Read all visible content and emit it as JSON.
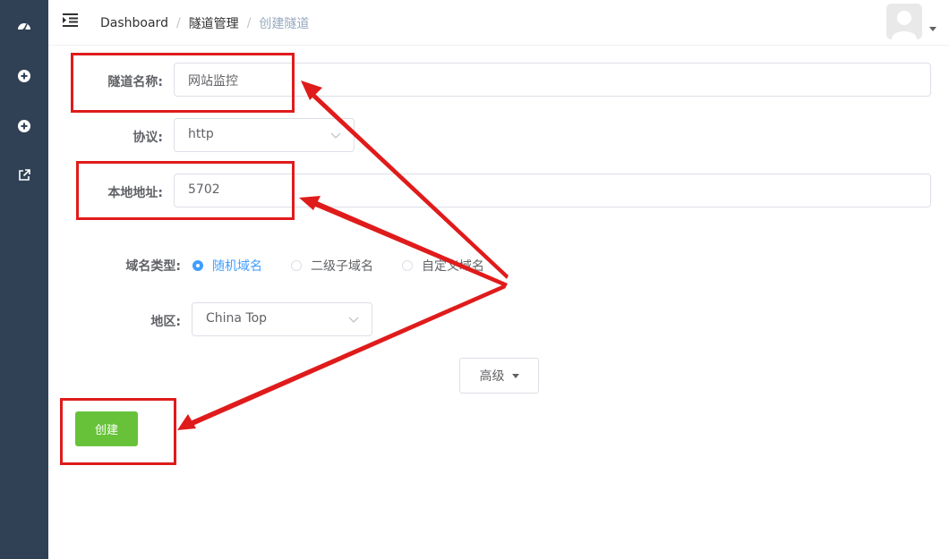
{
  "breadcrumb": {
    "home": "Dashboard",
    "separator": "/",
    "parent": "隧道管理",
    "current": "创建隧道"
  },
  "form": {
    "tunnel_name": {
      "label": "隧道名称:",
      "value": "网站监控"
    },
    "protocol": {
      "label": "协议:",
      "value": "http"
    },
    "local_address": {
      "label": "本地地址:",
      "value": "5702"
    },
    "domain_type": {
      "label": "域名类型:",
      "options": [
        "随机域名",
        "二级子域名",
        "自定义域名"
      ],
      "selected": "随机域名"
    },
    "region": {
      "label": "地区:",
      "value": "China Top"
    },
    "advanced_label": "高级",
    "create_label": "创建"
  },
  "icons": {
    "sidebar": [
      "dashboard-icon",
      "tunnel-icon",
      "tunnel-list-icon",
      "external-link-icon"
    ],
    "topbar": [
      "hamburger-icon",
      "avatar",
      "caret-down-icon"
    ]
  },
  "colors": {
    "sidebar_bg": "#304156",
    "primary": "#409eff",
    "success": "#67c23a",
    "annotation_red": "#e01b1b"
  }
}
